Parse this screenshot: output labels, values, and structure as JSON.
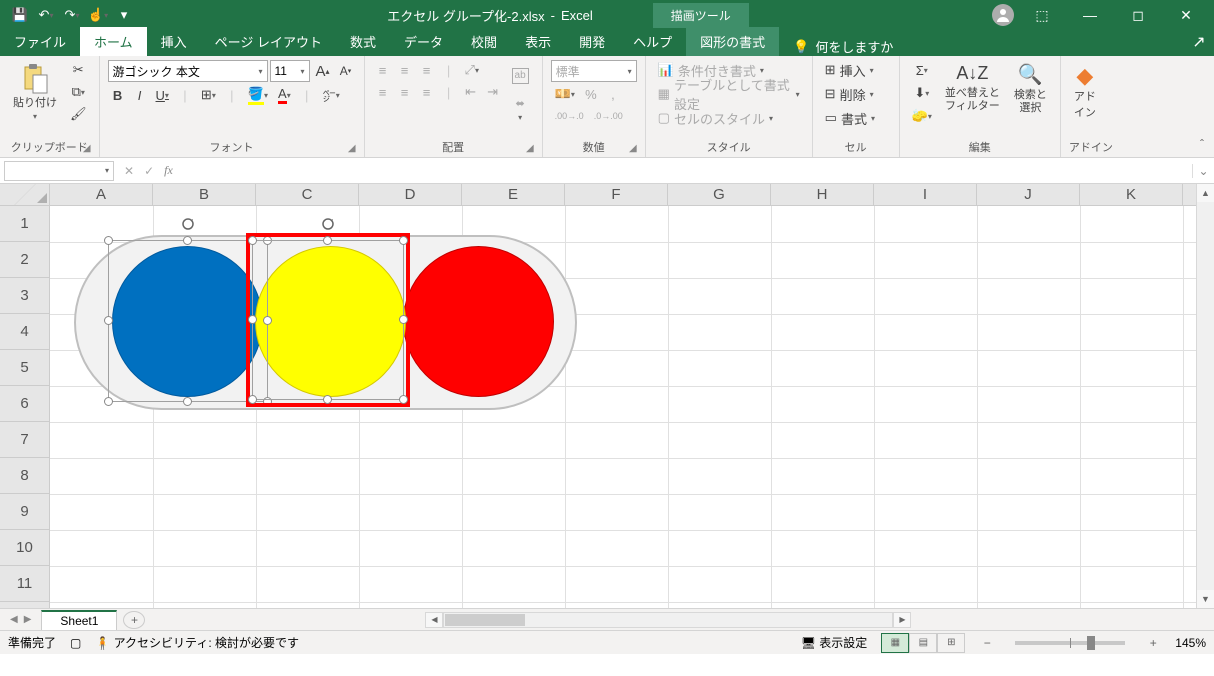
{
  "title": {
    "filename": "エクセル グループ化-2.xlsx",
    "app": "Excel",
    "contextual_tool": "描画ツール"
  },
  "window_controls": {
    "ribbon_opts": "⬚",
    "minimize": "—",
    "maximize": "◻",
    "close": "✕"
  },
  "qat": {
    "save": "💾",
    "undo": "↶",
    "redo": "↷",
    "touch": "☝",
    "more": "▾"
  },
  "tabs": {
    "file": "ファイル",
    "home": "ホーム",
    "insert": "挿入",
    "page_layout": "ページ レイアウト",
    "formulas": "数式",
    "data": "データ",
    "review": "校閲",
    "view": "表示",
    "developer": "開発",
    "help": "ヘルプ",
    "shape_format": "図形の書式",
    "tell_me": "何をしますか"
  },
  "ribbon": {
    "clipboard": {
      "paste": "貼り付け",
      "label": "クリップボード"
    },
    "font": {
      "name": "游ゴシック 本文",
      "size": "11",
      "bold": "B",
      "italic": "I",
      "underline": "U",
      "grow": "A",
      "shrink": "A",
      "label": "フォント"
    },
    "alignment": {
      "wrap": "ab",
      "label": "配置"
    },
    "number": {
      "style": "標準",
      "label": "数値"
    },
    "styles": {
      "cond": "条件付き書式",
      "table": "テーブルとして書式設定",
      "cell": "セルのスタイル",
      "label": "スタイル"
    },
    "cells": {
      "insert": "挿入",
      "delete": "削除",
      "format": "書式",
      "label": "セル"
    },
    "editing": {
      "sort": "並べ替えと\nフィルター",
      "find": "検索と\n選択",
      "label": "編集"
    },
    "addins": {
      "label_top": "アド",
      "label_bottom": "イン",
      "label": "アドイン"
    }
  },
  "formula_bar": {
    "fx": "fx"
  },
  "columns": [
    "A",
    "B",
    "C",
    "D",
    "E",
    "F",
    "G",
    "H",
    "I",
    "J",
    "K"
  ],
  "rows": [
    "1",
    "2",
    "3",
    "4",
    "5",
    "6",
    "7",
    "8",
    "9",
    "10",
    "11"
  ],
  "sheet": {
    "name": "Sheet1"
  },
  "status": {
    "ready": "準備完了",
    "accessibility": "アクセシビリティ: 検討が必要です",
    "display": "表示設定",
    "zoom": "145%"
  }
}
